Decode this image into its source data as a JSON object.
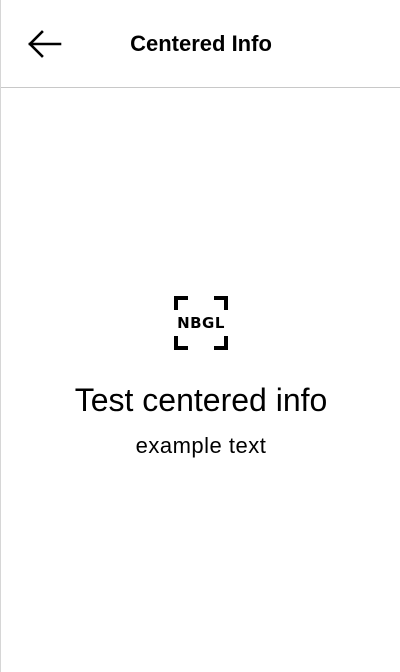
{
  "header": {
    "title": "Centered Info",
    "back_icon": "arrow-left-icon"
  },
  "content": {
    "logo_icon": "nbgl-frame-icon",
    "logo_text": "NBGL",
    "title": "Test centered info",
    "subtitle": "example text"
  }
}
